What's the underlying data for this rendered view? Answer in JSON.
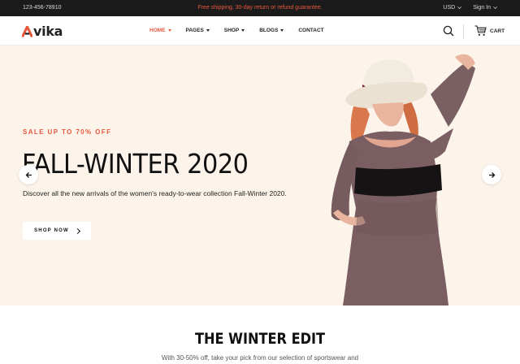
{
  "topbar": {
    "phone": "123-456-78910",
    "promo": "Free shipping, 30-day return or refund guarantee.",
    "currency": "USD",
    "signin": "Sign In"
  },
  "header": {
    "logo_text": "vika",
    "nav": [
      {
        "label": "HOME",
        "active": true,
        "has_caret": true
      },
      {
        "label": "PAGES",
        "active": false,
        "has_caret": true
      },
      {
        "label": "SHOP",
        "active": false,
        "has_caret": true
      },
      {
        "label": "BLOGS",
        "active": false,
        "has_caret": true
      },
      {
        "label": "CONTACT",
        "active": false,
        "has_caret": false
      }
    ],
    "cart_label": "CART"
  },
  "hero": {
    "eyebrow": "SALE UP TO 70% OFF",
    "headline": "FALL-WINTER 2020",
    "description": "Discover all the new arrivals of the women's ready-to-wear collection Fall-Winter 2020.",
    "cta": "SHOP NOW"
  },
  "section": {
    "title": "THE WINTER EDIT",
    "subtitle": "With 30-50% off, take your pick from our selection of sportswear and"
  },
  "colors": {
    "accent": "#e8573d",
    "topbar_bg": "#1b1b1b",
    "hero_bg": "#fcf4ea"
  },
  "icons": [
    "search-icon",
    "cart-icon",
    "arrow-left-icon",
    "arrow-right-icon",
    "chevron-down-icon",
    "arrow-right-small-icon"
  ]
}
